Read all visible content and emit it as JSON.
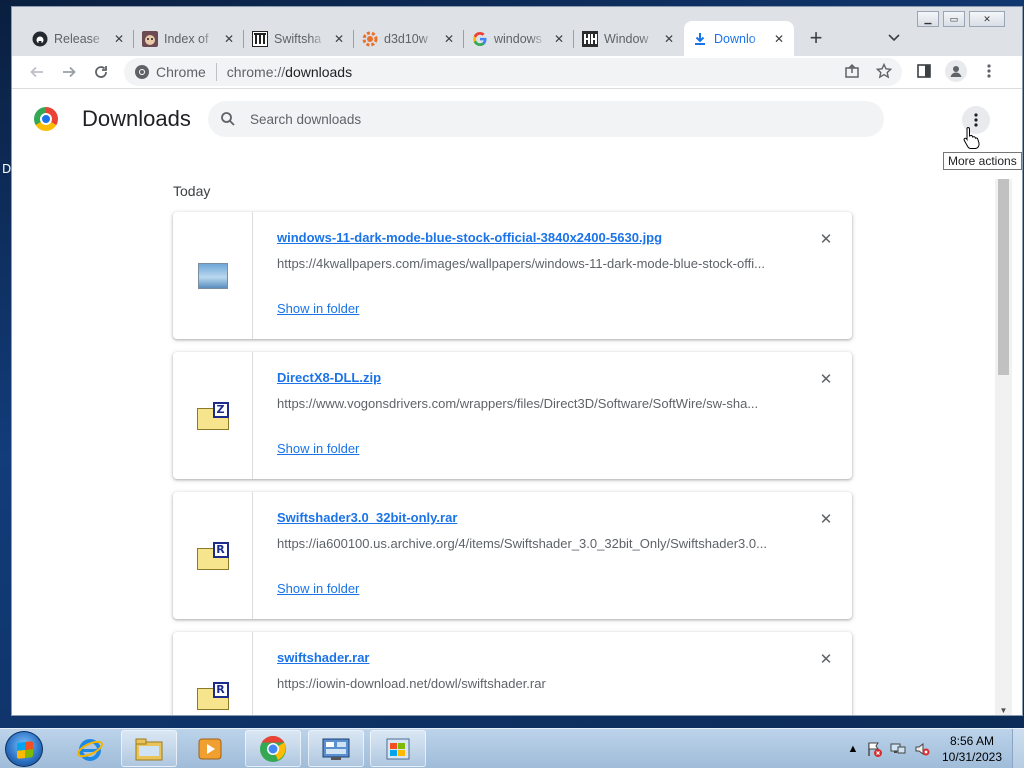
{
  "tabs": [
    {
      "title": "Release",
      "favicon": "github-icon"
    },
    {
      "title": "Index of",
      "favicon": "cat-icon"
    },
    {
      "title": "Swiftsha",
      "favicon": "building-icon"
    },
    {
      "title": "d3d10w",
      "favicon": "gear-orange-icon"
    },
    {
      "title": "windows",
      "favicon": "google-icon"
    },
    {
      "title": "Window",
      "favicon": "windows-hh-icon"
    },
    {
      "title": "Downlo",
      "favicon": "download-icon",
      "active": true
    }
  ],
  "omnibox": {
    "chip_label": "Chrome",
    "url_scheme": "chrome://",
    "url_host": "downloads"
  },
  "page": {
    "title": "Downloads",
    "search_placeholder": "Search downloads",
    "more_actions_tooltip": "More actions",
    "section_date": "Today"
  },
  "downloads": [
    {
      "filename": "windows-11-dark-mode-blue-stock-official-3840x2400-5630.jpg",
      "url": "https://4kwallpapers.com/images/wallpapers/windows-11-dark-mode-blue-stock-offi...",
      "action": "Show in folder",
      "icon": "image-file-icon"
    },
    {
      "filename": "DirectX8-DLL.zip",
      "url": "https://www.vogonsdrivers.com/wrappers/files/Direct3D/Software/SoftWire/sw-sha...",
      "action": "Show in folder",
      "icon": "zip-archive-icon",
      "badge": "Z"
    },
    {
      "filename": "Swiftshader3.0_32bit-only.rar",
      "url": "https://ia600100.us.archive.org/4/items/Swiftshader_3.0_32bit_Only/Swiftshader3.0...",
      "action": "Show in folder",
      "icon": "rar-archive-icon",
      "badge": "R"
    },
    {
      "filename": "swiftshader.rar",
      "url": "https://iowin-download.net/dowl/swiftshader.rar",
      "action": "",
      "icon": "rar-archive-icon",
      "badge": "R"
    }
  ],
  "desktop": {
    "partial_label": "D"
  },
  "taskbar": {
    "time": "8:56 AM",
    "date": "10/31/2023"
  }
}
